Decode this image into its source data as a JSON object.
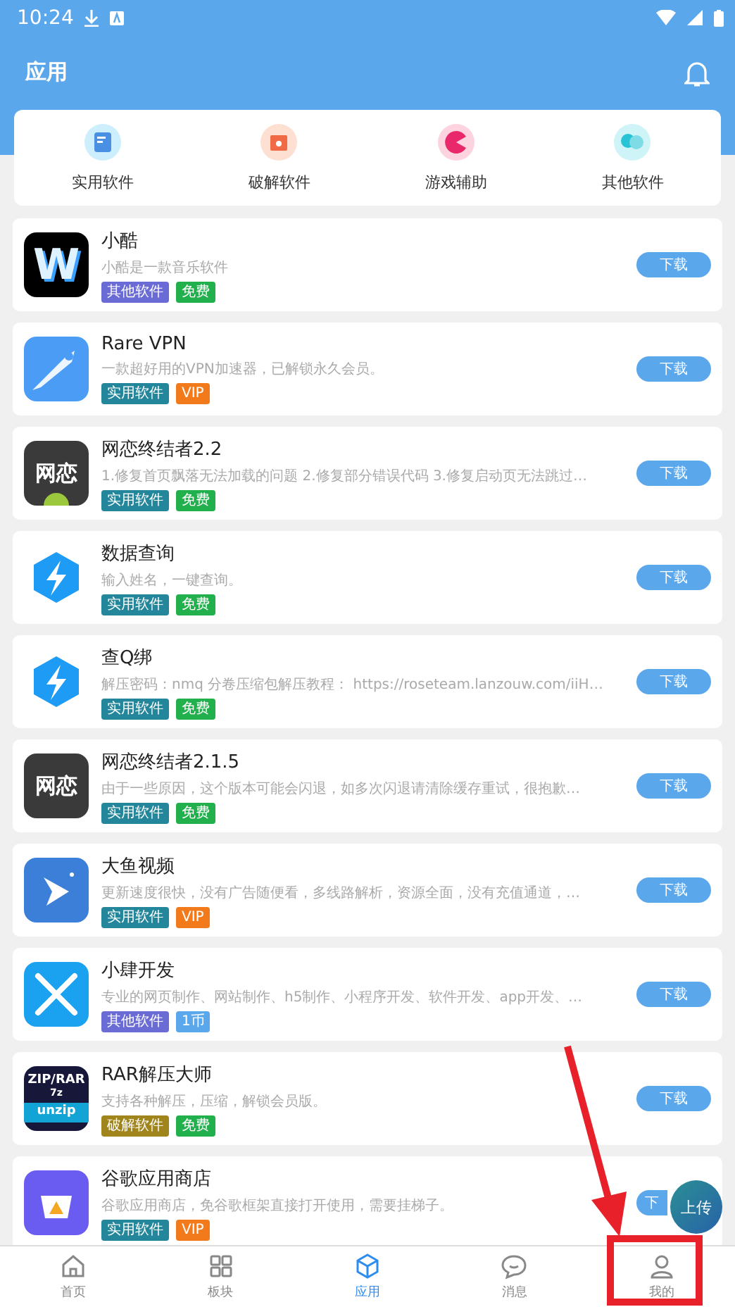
{
  "status_bar": {
    "time": "10:24"
  },
  "header": {
    "title": "应用"
  },
  "categories": [
    {
      "label": "实用软件",
      "kind": "doc"
    },
    {
      "label": "破解软件",
      "kind": "gift"
    },
    {
      "label": "游戏辅助",
      "kind": "game"
    },
    {
      "label": "其他软件",
      "kind": "chat"
    }
  ],
  "apps": [
    {
      "name": "小酷",
      "description": "小酷是一款音乐软件",
      "icon": {
        "kind": "w",
        "text": "W"
      },
      "tags": [
        {
          "label": "其他软件",
          "color": "#6b6bd6"
        },
        {
          "label": "免费",
          "color": "#21b04b"
        }
      ],
      "button": "下载"
    },
    {
      "name": "Rare VPN",
      "description": "一款超好用的VPN加速器，已解锁永久会员。",
      "icon": {
        "kind": "rocket"
      },
      "tags": [
        {
          "label": "实用软件",
          "color": "#23869a"
        },
        {
          "label": "VIP",
          "color": "#f27a1a"
        }
      ],
      "button": "下载"
    },
    {
      "name": "网恋终结者2.2",
      "description": "1.修复首页飘落无法加载的问题 2.修复部分错误代码 3.修复启动页无法跳过…",
      "icon": {
        "kind": "android",
        "text": "网恋"
      },
      "tags": [
        {
          "label": "实用软件",
          "color": "#23869a"
        },
        {
          "label": "免费",
          "color": "#21b04b"
        }
      ],
      "button": "下载"
    },
    {
      "name": "数据查询",
      "description": "输入姓名，一键查询。",
      "icon": {
        "kind": "bolt"
      },
      "tags": [
        {
          "label": "实用软件",
          "color": "#23869a"
        },
        {
          "label": "免费",
          "color": "#21b04b"
        }
      ],
      "button": "下载"
    },
    {
      "name": "查Q绑",
      "description": "解压密码：nmq 分卷压缩包解压教程： https://roseteam.lanzouw.com/iiH…",
      "icon": {
        "kind": "bolt"
      },
      "tags": [
        {
          "label": "实用软件",
          "color": "#23869a"
        },
        {
          "label": "免费",
          "color": "#21b04b"
        }
      ],
      "button": "下载"
    },
    {
      "name": "网恋终结者2.1.5",
      "description": "由于一些原因，这个版本可能会闪退，如多次闪退请清除缓存重试，很抱歉…",
      "icon": {
        "kind": "dark",
        "text": "网恋"
      },
      "tags": [
        {
          "label": "实用软件",
          "color": "#23869a"
        },
        {
          "label": "免费",
          "color": "#21b04b"
        }
      ],
      "button": "下载"
    },
    {
      "name": "大鱼视频",
      "description": "更新速度很快，没有广告随便看，多线路解析，资源全面，没有充值通道，…",
      "icon": {
        "kind": "fish"
      },
      "tags": [
        {
          "label": "实用软件",
          "color": "#23869a"
        },
        {
          "label": "VIP",
          "color": "#f27a1a"
        }
      ],
      "button": "下载"
    },
    {
      "name": "小肆开发",
      "description": "专业的网页制作、网站制作、h5制作、小程序开发、软件开发、app开发、…",
      "icon": {
        "kind": "cross"
      },
      "tags": [
        {
          "label": "其他软件",
          "color": "#6b6bd6"
        },
        {
          "label": "1币",
          "color": "#5aa7ec"
        }
      ],
      "button": "下载"
    },
    {
      "name": "RAR解压大师",
      "description": "支持各种解压，压缩，解锁会员版。",
      "icon": {
        "kind": "zip",
        "text": "ZIP/RAR",
        "subtext": "7z",
        "footer": "unzip"
      },
      "tags": [
        {
          "label": "破解软件",
          "color": "#a0841c"
        },
        {
          "label": "免费",
          "color": "#21b04b"
        }
      ],
      "button": "下载"
    },
    {
      "name": "谷歌应用商店",
      "description": "谷歌应用商店，免谷歌框架直接打开使用，需要挂梯子。",
      "icon": {
        "kind": "store"
      },
      "tags": [
        {
          "label": "实用软件",
          "color": "#23869a"
        },
        {
          "label": "VIP",
          "color": "#f27a1a"
        }
      ],
      "button": "下"
    }
  ],
  "upload_button": "上传",
  "nav": [
    {
      "label": "首页",
      "kind": "home",
      "selected": false
    },
    {
      "label": "板块",
      "kind": "grid",
      "selected": false
    },
    {
      "label": "应用",
      "kind": "cube",
      "selected": true
    },
    {
      "label": "消息",
      "kind": "chat",
      "selected": false
    },
    {
      "label": "我的",
      "kind": "user",
      "selected": false
    }
  ],
  "annotation": {
    "kind": "arrow_frame"
  }
}
